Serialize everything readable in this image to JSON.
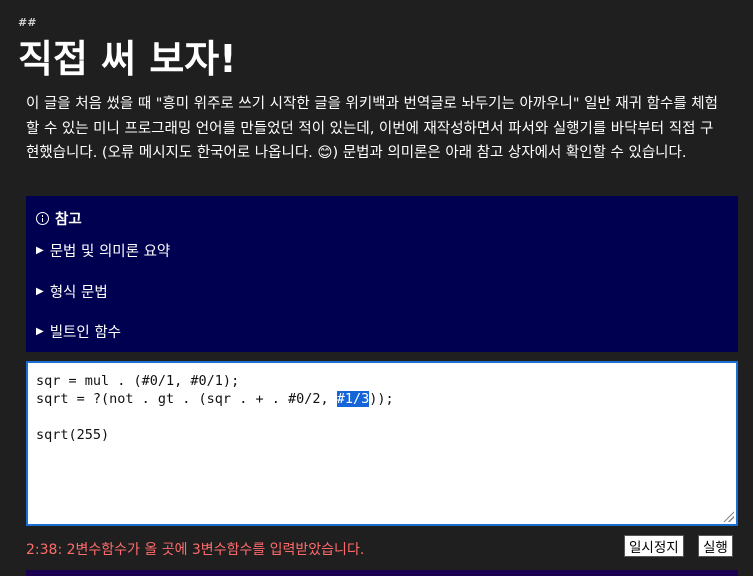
{
  "heading": {
    "anchor": "##",
    "title": "직접 써 보자!"
  },
  "intro": {
    "text": "이 글을 처음 썼을 때 \"흥미 위주로 쓰기 시작한 글을 위키백과 번역글로 놔두기는 아까우니\" 일반 재귀 함수를 체험할 수 있는 미니 프로그래밍 언어를 만들었던 적이 있는데, 이번에 재작성하면서 파서와 실행기를 바닥부터 직접 구현했습니다. (오류 메시지도 한국어로 나옵니다. 😊) 문법과 의미론은 아래 참고 상자에서 확인할 수 있습니다."
  },
  "note": {
    "title": "참고",
    "sections": [
      {
        "label": "문법 및 의미론 요약"
      },
      {
        "label": "형식 문법"
      },
      {
        "label": "빌트인 함수"
      }
    ]
  },
  "editor": {
    "line1": "sqr = mul . (#0/1, #0/1);",
    "line2_before": "sqrt = ?(not . gt . (sqr . + . #0/2, ",
    "line2_selected": "#1/3",
    "line2_after": "));",
    "line4": "sqrt(255)"
  },
  "status": {
    "error": "2:38: 2변수함수가 올 곳에 3변수함수를 입력받았습니다."
  },
  "buttons": {
    "pause": "일시정지",
    "run": "실행"
  },
  "colors": {
    "note_bg": "#000050",
    "error": "#ff6b6b",
    "selection": "#1565d8",
    "editor_border": "#1a6fd1"
  }
}
